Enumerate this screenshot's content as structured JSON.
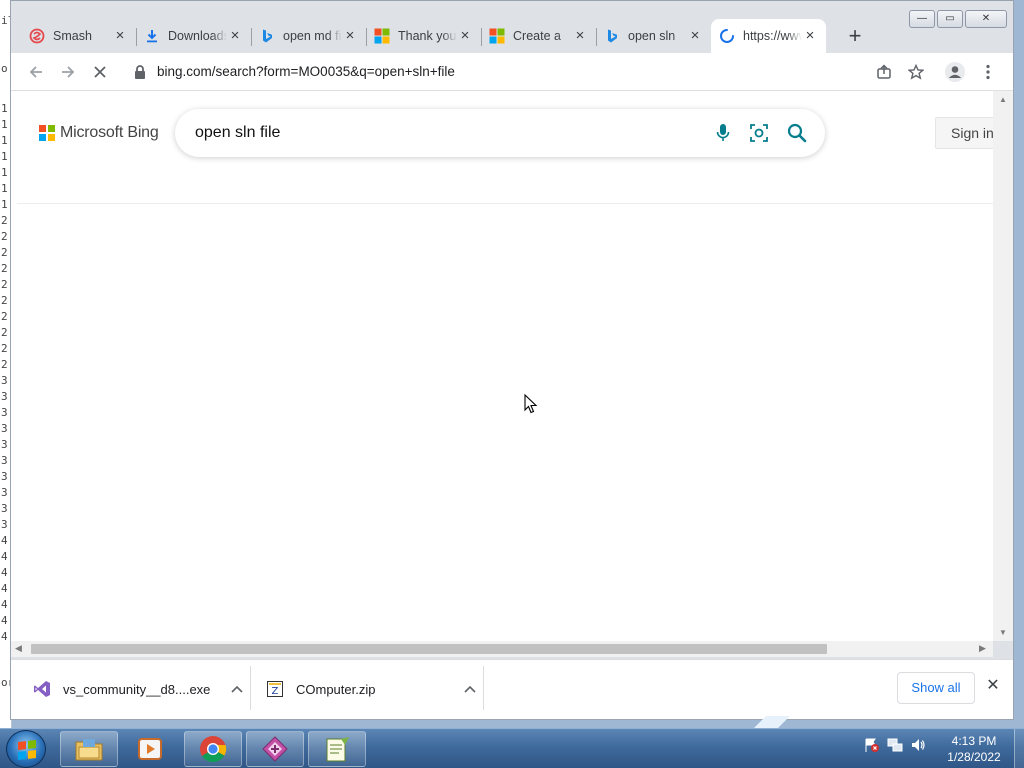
{
  "browser": {
    "tabs": [
      {
        "label": "Smash",
        "icon": "smash-favicon",
        "active": false
      },
      {
        "label": "Downloads",
        "icon": "download-favicon",
        "active": false
      },
      {
        "label": "open md file",
        "icon": "bing-favicon",
        "active": false
      },
      {
        "label": "Thank you",
        "icon": "microsoft-favicon",
        "active": false
      },
      {
        "label": "Create a",
        "icon": "microsoft-favicon",
        "active": false
      },
      {
        "label": "open sln",
        "icon": "bing-favicon",
        "active": false
      },
      {
        "label": "https://www",
        "icon": "loading-spinner",
        "active": true
      }
    ],
    "new_tab_label": "+",
    "window_controls": {
      "minimize": "—",
      "maximize": "▭",
      "close": "✕"
    },
    "url": "bing.com/search?form=MO0035&q=open+sln+file"
  },
  "page": {
    "brand": "Microsoft Bing",
    "search_query": "open sln file",
    "sign_in_label": "Sign in"
  },
  "downloads": {
    "items": [
      {
        "name": "vs_community__d8....exe",
        "icon": "visual-studio-icon"
      },
      {
        "name": "COmputer.zip",
        "icon": "zip-file-icon"
      }
    ],
    "show_all_label": "Show all",
    "close_label": "✕"
  },
  "taskbar": {
    "apps": [
      "explorer",
      "media-player",
      "chrome",
      "app-diamond",
      "notepad-plus"
    ],
    "clock_time": "4:13 PM",
    "clock_date": "1/28/2022"
  },
  "colors": {
    "ms_red": "#f25022",
    "ms_green": "#7fba00",
    "ms_blue": "#00a4ef",
    "ms_yellow": "#ffb900",
    "bing_teal": "#067d8d",
    "link_blue": "#1a73e8"
  }
}
